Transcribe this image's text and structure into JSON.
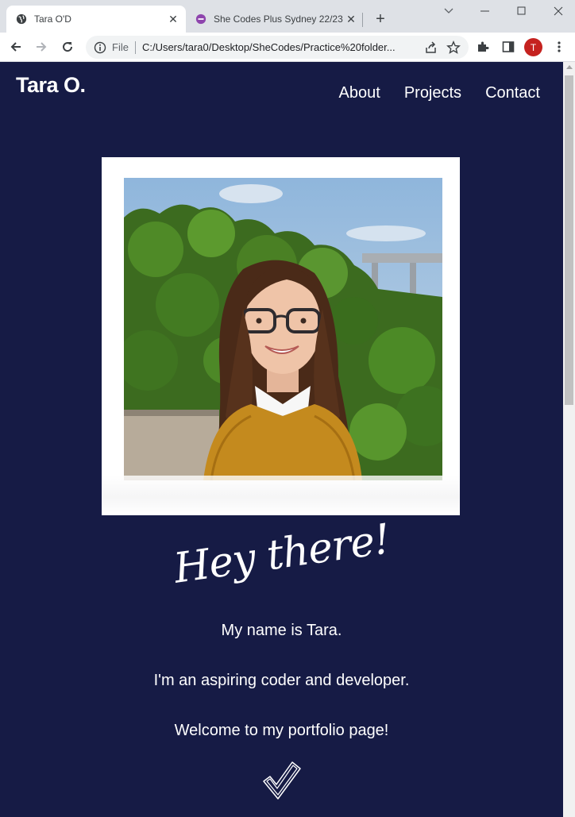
{
  "browser": {
    "tabs": [
      {
        "title": "Tara O'D",
        "active": true,
        "icon": "globe-icon"
      },
      {
        "title": "She Codes Plus Sydney 22/23",
        "active": false,
        "icon": "shecodes-favicon"
      }
    ],
    "address": {
      "scheme_label": "File",
      "url": "C:/Users/tara0/Desktop/SheCodes/Practice%20folder..."
    },
    "profile_initial": "T"
  },
  "site": {
    "brand": "Tara O.",
    "nav": [
      "About",
      "Projects",
      "Contact"
    ],
    "greeting": "Hey there!",
    "intro_lines": [
      "My name is Tara.",
      "I'm an aspiring coder and developer.",
      "Welcome to my portfolio page!"
    ],
    "photo_alt": "Portrait photo",
    "colors": {
      "page_background": "#161b45",
      "text": "#ffffff",
      "frame": "#ffffff",
      "sweater": "#c48a1e"
    }
  }
}
